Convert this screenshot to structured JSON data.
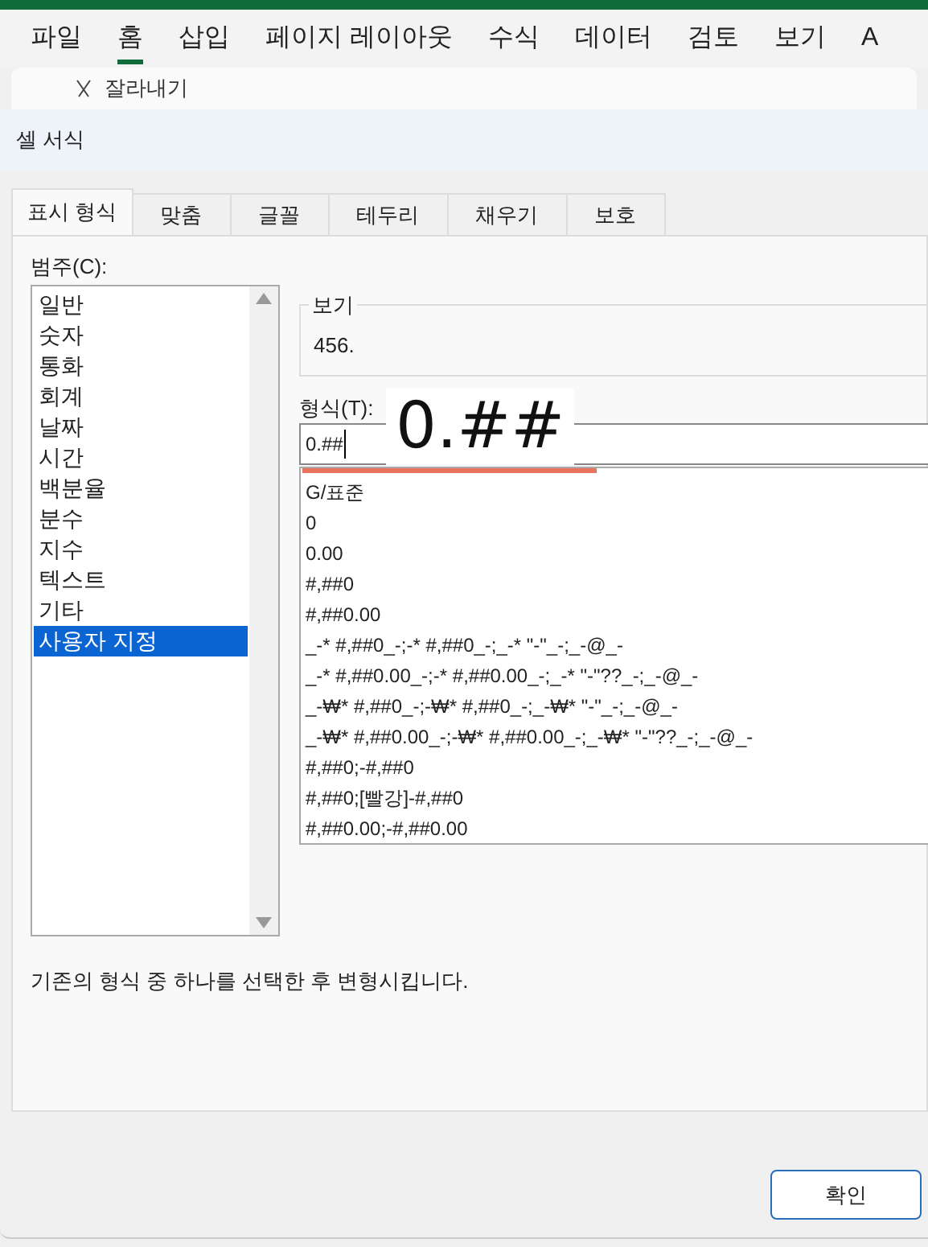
{
  "menu": [
    {
      "label": "파일",
      "selected": false
    },
    {
      "label": "홈",
      "selected": true
    },
    {
      "label": "삽입",
      "selected": false
    },
    {
      "label": "페이지 레이아웃",
      "selected": false
    },
    {
      "label": "수식",
      "selected": false
    },
    {
      "label": "데이터",
      "selected": false
    },
    {
      "label": "검토",
      "selected": false
    },
    {
      "label": "보기",
      "selected": false
    },
    {
      "label": "A",
      "selected": false
    }
  ],
  "ribbon": {
    "cut_label": "잘라내기"
  },
  "dialog": {
    "title": "셀 서식",
    "tabs": [
      {
        "label": "표시 형식",
        "selected": true
      },
      {
        "label": "맞춤",
        "selected": false
      },
      {
        "label": "글꼴",
        "selected": false
      },
      {
        "label": "테두리",
        "selected": false
      },
      {
        "label": "채우기",
        "selected": false
      },
      {
        "label": "보호",
        "selected": false
      }
    ],
    "category_label": "범주(C):",
    "categories": [
      {
        "label": "일반",
        "selected": false
      },
      {
        "label": "숫자",
        "selected": false
      },
      {
        "label": "통화",
        "selected": false
      },
      {
        "label": "회계",
        "selected": false
      },
      {
        "label": "날짜",
        "selected": false
      },
      {
        "label": "시간",
        "selected": false
      },
      {
        "label": "백분율",
        "selected": false
      },
      {
        "label": "분수",
        "selected": false
      },
      {
        "label": "지수",
        "selected": false
      },
      {
        "label": "텍스트",
        "selected": false
      },
      {
        "label": "기타",
        "selected": false
      },
      {
        "label": "사용자 지정",
        "selected": true
      }
    ],
    "sample_label": "보기",
    "sample_value": "456.",
    "type_label": "형식(T):",
    "type_value": "0.##",
    "formats": [
      "G/표준",
      "0",
      "0.00",
      "#,##0",
      "#,##0.00",
      "_-* #,##0_-;-* #,##0_-;_-* \"-\"_-;_-@_-",
      "_-* #,##0.00_-;-* #,##0.00_-;_-* \"-\"??_-;_-@_-",
      "_-₩* #,##0_-;-₩* #,##0_-;_-₩* \"-\"_-;_-@_-",
      "_-₩* #,##0.00_-;-₩* #,##0.00_-;_-₩* \"-\"??_-;_-@_-",
      "#,##0;-#,##0",
      "#,##0;[빨강]-#,##0",
      "#,##0.00;-#,##0.00"
    ],
    "hint": "기존의 형식 중 하나를 선택한 후 변형시킵니다.",
    "ok_button": "확인"
  },
  "annotation": {
    "text": "0.##"
  }
}
